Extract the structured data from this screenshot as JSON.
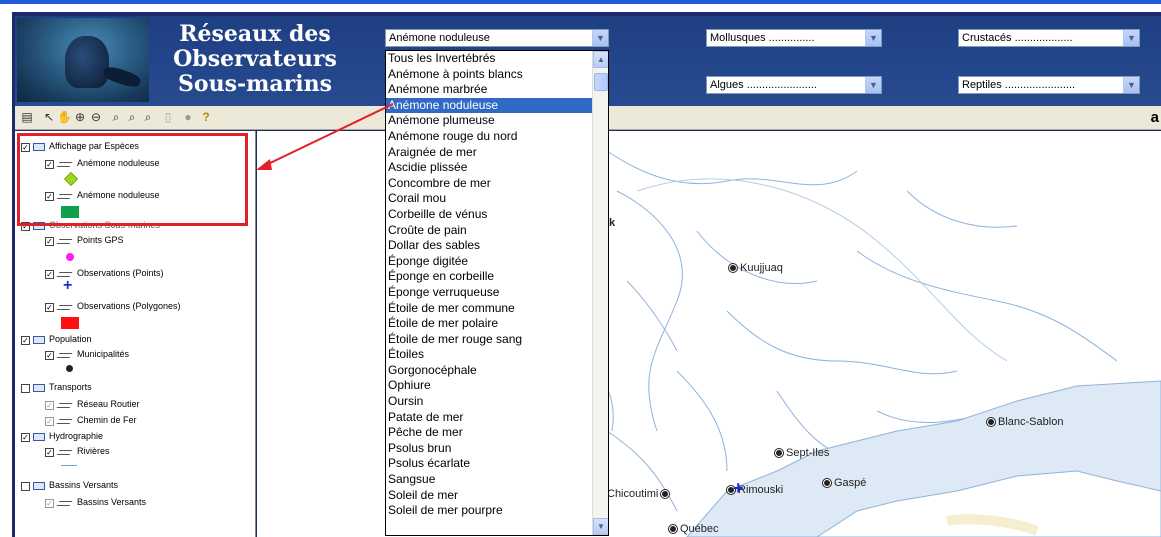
{
  "header": {
    "title_lines": [
      "Réseaux des",
      "Observateurs",
      "Sous-marins"
    ],
    "select_species": "Anémone noduleuse",
    "select_molluscs": "Mollusques ...............",
    "select_crustaceans": "Crustacés ...................",
    "select_algae": "Algues .......................",
    "select_reptiles": "Reptiles ......................."
  },
  "toolbar": {
    "icons": [
      "layers-icon",
      "pointer-icon",
      "pan-icon",
      "zoom-in-icon",
      "zoom-out-icon",
      "zoom-prev-icon",
      "zoom-extent-icon",
      "zoom-layer-icon",
      "print-icon",
      "identify-icon",
      "help-icon"
    ],
    "right_text": "a"
  },
  "legend": {
    "group_species": "Affichage par Espèces",
    "species_layer_1": "Anémone noduleuse",
    "species_layer_2": "Anémone noduleuse",
    "group_observations": "Observations Sous-marines",
    "layer_gps": "Points GPS",
    "layer_obs_points": "Observations (Points)",
    "layer_obs_polygons": "Observations (Polygones)",
    "group_population": "Population",
    "layer_municipalities": "Municipalités",
    "group_transport": "Transports",
    "layer_roads": "Réseau Routier",
    "layer_rail": "Chemin de Fer",
    "group_hydro": "Hydrographie",
    "layer_rivers": "Rivières",
    "group_watersheds": "Bassins Versants",
    "layer_watersheds": "Bassins Versants",
    "colors": {
      "species_1": "#9bd81f",
      "species_2": "#0fa049",
      "gps": "#ff1ef0",
      "obs_points": "#1f2bd8",
      "obs_polygons": "#ff1010"
    }
  },
  "dropdown": {
    "selected": "Anémone noduleuse",
    "items": [
      "Tous les Invertébrés",
      "Anémone à points blancs",
      "Anémone marbrée",
      "Anémone noduleuse",
      "Anémone plumeuse",
      "Anémone rouge du nord",
      "Araignée de mer",
      "Ascidie plissée",
      "Concombre de mer",
      "Corail mou",
      "Corbeille de vénus",
      "Croûte de pain",
      "Dollar des sables",
      "Éponge digitée",
      "Éponge en corbeille",
      "Éponge verruqueuse",
      "Étoile de mer commune",
      "Étoile de mer polaire",
      "Étoile de mer rouge sang",
      "Étoiles",
      "Gorgonocéphale",
      "Ophiure",
      "Oursin",
      "Patate de mer",
      "Pêche de mer",
      "Psolus brun",
      "Psolus écarlate",
      "Sangsue",
      "Soleil de mer",
      "Soleil de mer pourpre"
    ]
  },
  "map": {
    "cities": {
      "kuujjuaq": "Kuujjuaq",
      "blanc_sablon": "Blanc-Sablon",
      "sept_iles": "Sept-Iles",
      "gaspe": "Gaspé",
      "rimouski": "Rimouski",
      "chicoutimi": "Chicoutimi",
      "quebec": "Québec",
      "partial_k": "k"
    }
  },
  "accent_colors": {
    "header_bg": "#274a90",
    "annotation_red": "#e2202a",
    "selection_blue": "#316ac5"
  }
}
